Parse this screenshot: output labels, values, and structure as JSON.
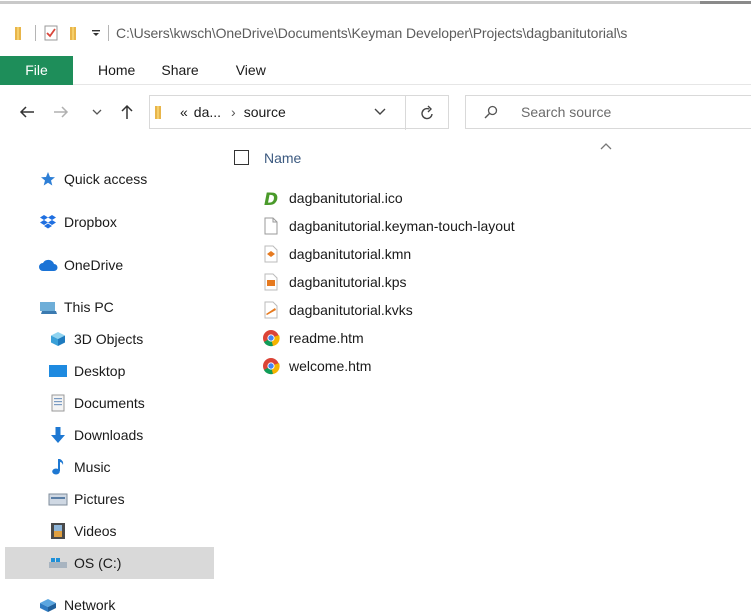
{
  "window": {
    "path": "C:\\Users\\kwsch\\OneDrive\\Documents\\Keyman Developer\\Projects\\dagbanitutorial\\s"
  },
  "ribbon": {
    "tabs": [
      "File",
      "Home",
      "Share",
      "View"
    ]
  },
  "address": {
    "crumbs": [
      "«",
      "da...",
      "›",
      "source"
    ],
    "search_placeholder": "Search source"
  },
  "sidebar": {
    "items": [
      {
        "label": "Quick access",
        "icon": "star-icon"
      },
      {
        "label": "Dropbox",
        "icon": "dropbox-icon"
      },
      {
        "label": "OneDrive",
        "icon": "cloud-icon"
      },
      {
        "label": "This PC",
        "icon": "computer-icon"
      },
      {
        "label": "3D Objects",
        "icon": "cube-icon"
      },
      {
        "label": "Desktop",
        "icon": "desktop-icon"
      },
      {
        "label": "Documents",
        "icon": "document-icon"
      },
      {
        "label": "Downloads",
        "icon": "download-arrow-icon"
      },
      {
        "label": "Music",
        "icon": "music-note-icon"
      },
      {
        "label": "Pictures",
        "icon": "pictures-icon"
      },
      {
        "label": "Videos",
        "icon": "film-icon"
      },
      {
        "label": "OS (C:)",
        "icon": "drive-icon",
        "selected": true
      },
      {
        "label": "Network",
        "icon": "network-icon"
      }
    ]
  },
  "files": {
    "column_header": "Name",
    "items": [
      {
        "name": "dagbanitutorial.ico",
        "icon": "keyman-ico-icon"
      },
      {
        "name": "dagbanitutorial.keyman-touch-layout",
        "icon": "blank-file-icon"
      },
      {
        "name": "dagbanitutorial.kmn",
        "icon": "keyman-file-icon"
      },
      {
        "name": "dagbanitutorial.kps",
        "icon": "keyman-package-icon"
      },
      {
        "name": "dagbanitutorial.kvks",
        "icon": "keyman-keyboard-icon"
      },
      {
        "name": "readme.htm",
        "icon": "chrome-icon"
      },
      {
        "name": "welcome.htm",
        "icon": "chrome-icon"
      }
    ]
  },
  "colors": {
    "file_tab": "#1e8e5a",
    "header_text": "#3c5a80",
    "selected_bg": "#d9d9d9"
  }
}
